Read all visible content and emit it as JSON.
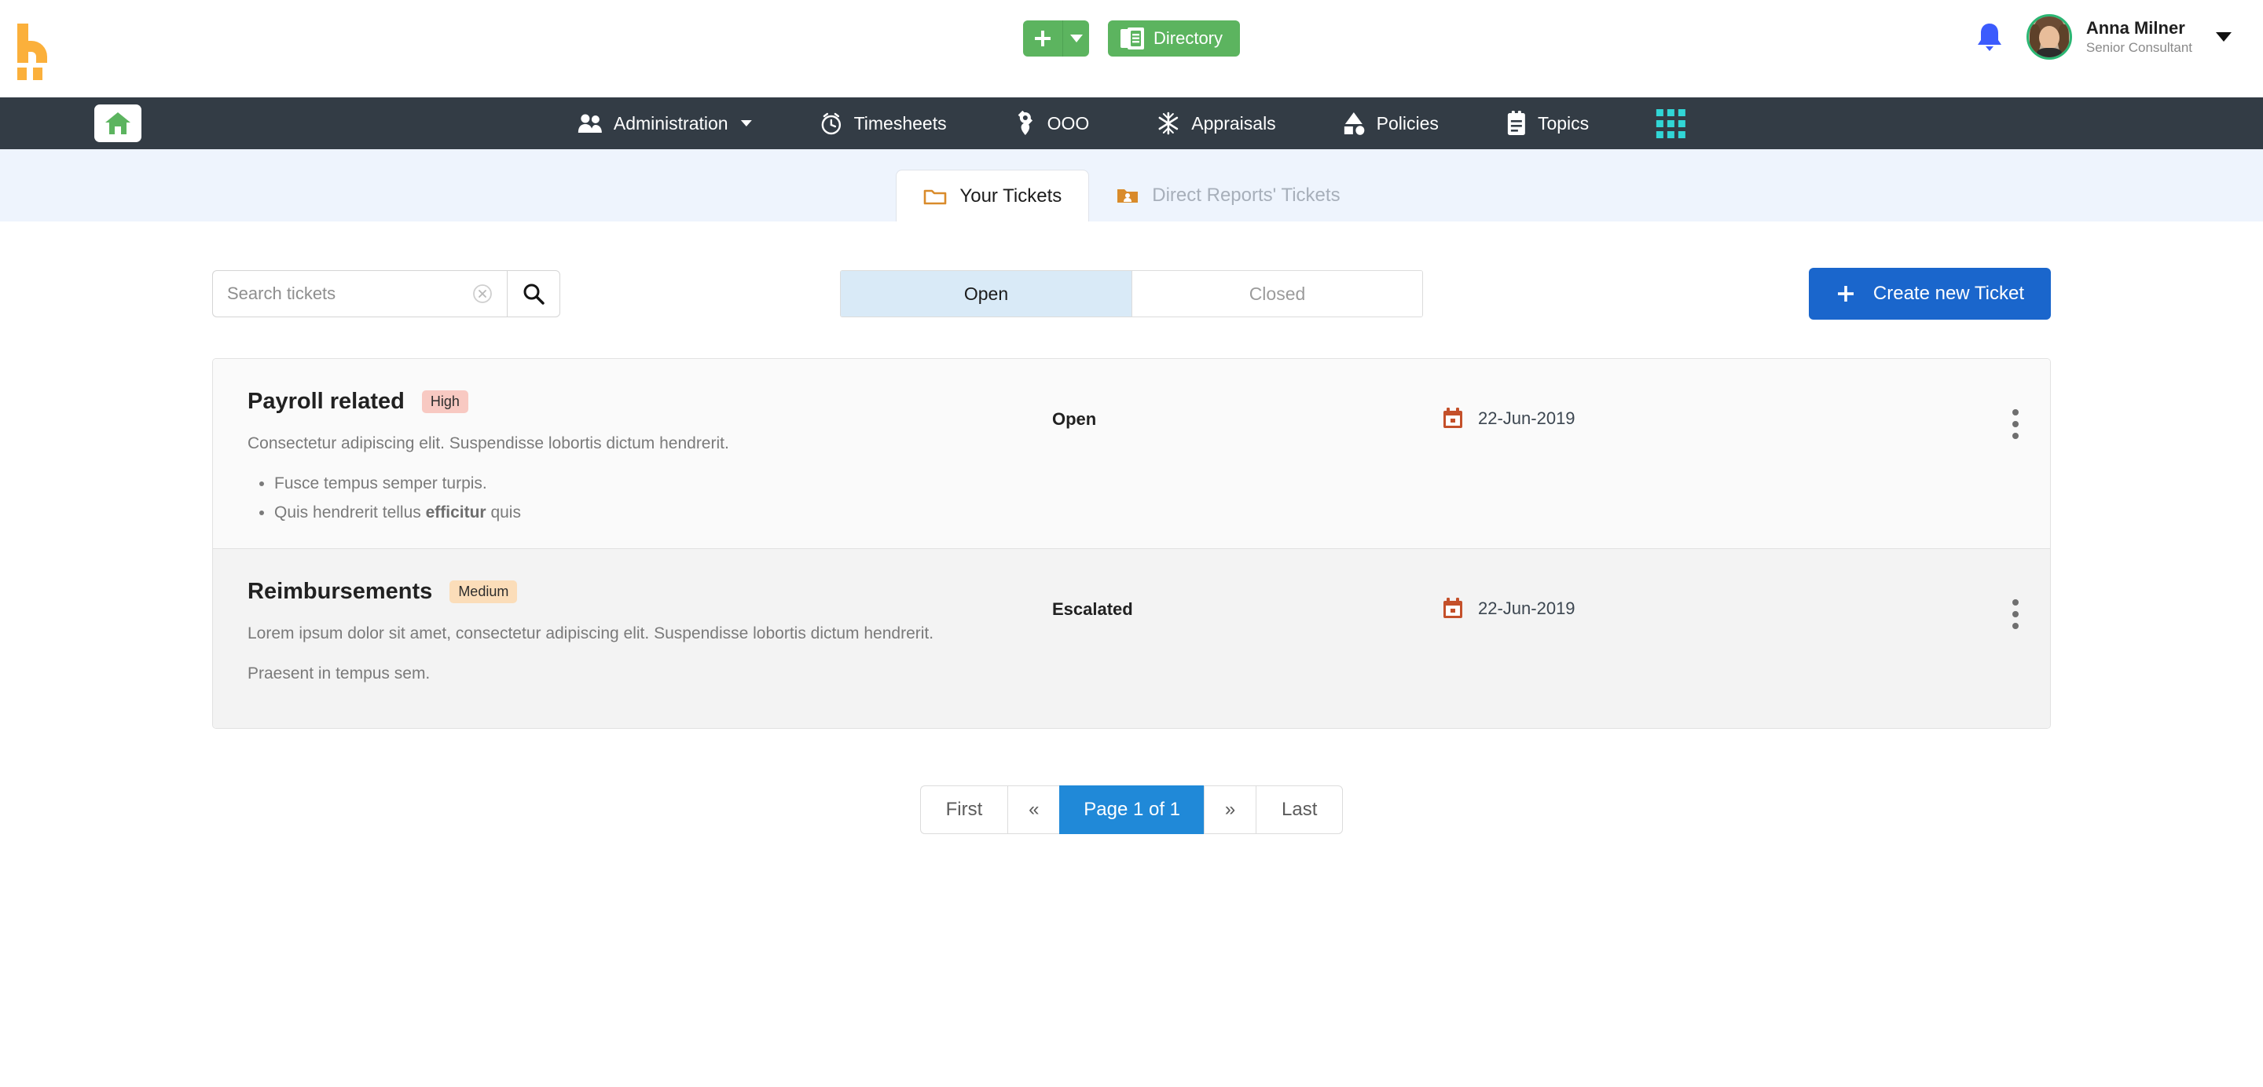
{
  "brand": {
    "logo_icon": "hibob-h-logo",
    "accent": "#fbb03b"
  },
  "topbar": {
    "add_button": {
      "label": "+",
      "icon": "plus-icon",
      "color": "#5cb45f"
    },
    "add_dropdown": {
      "icon": "caret-down-icon"
    },
    "directory_button": {
      "label": "Directory",
      "icon": "address-book-icon"
    },
    "notifications": {
      "icon": "bell-icon",
      "color": "#3b5bfd"
    },
    "user": {
      "name": "Anna Milner",
      "role": "Senior Consultant",
      "avatar_icon": "user-avatar",
      "caret_icon": "caret-down-icon",
      "ring_color": "#2bb673"
    }
  },
  "nav": {
    "home": {
      "icon": "home-icon",
      "color": "#5cb45f"
    },
    "bar_color": "#333c45",
    "items": [
      {
        "label": "Administration",
        "icon": "people-icon",
        "has_caret": true
      },
      {
        "label": "Timesheets",
        "icon": "alarm-clock-icon",
        "has_caret": false
      },
      {
        "label": "OOO",
        "icon": "flower-icon",
        "has_caret": false
      },
      {
        "label": "Appraisals",
        "icon": "asterisk-star-icon",
        "has_caret": false
      },
      {
        "label": "Policies",
        "icon": "shapes-icon",
        "has_caret": false
      },
      {
        "label": "Topics",
        "icon": "clipboard-icon",
        "has_caret": false
      }
    ],
    "apps": {
      "icon": "apps-grid-icon",
      "color": "#31d6d6"
    }
  },
  "tabs": [
    {
      "label": "Your Tickets",
      "icon": "folder-outline-icon",
      "active": true
    },
    {
      "label": "Direct Reports' Tickets",
      "icon": "folder-user-icon",
      "active": false
    }
  ],
  "toolbar": {
    "search": {
      "value": "",
      "placeholder": "Search tickets",
      "clear_icon": "circle-x-icon",
      "search_icon": "search-icon"
    },
    "segments": [
      {
        "label": "Open",
        "active": true
      },
      {
        "label": "Closed",
        "active": false
      }
    ],
    "create_button": {
      "label": "Create new Ticket",
      "icon": "plus-icon",
      "color": "#1a66cc"
    }
  },
  "tickets": [
    {
      "title": "Payroll related",
      "priority": "High",
      "priority_color": "#f8c9c2",
      "description": "Consectetur adipiscing elit. Suspendisse lobortis dictum hendrerit.",
      "bullets": [
        {
          "text": "Fusce tempus semper turpis.",
          "bold": ""
        },
        {
          "text": "Quis hendrerit tellus ",
          "bold": "efficitur",
          "tail": " quis"
        }
      ],
      "extra": "",
      "status": "Open",
      "date": "22-Jun-2019",
      "date_icon": "calendar-icon",
      "menu_icon": "kebab-menu-icon"
    },
    {
      "title": "Reimbursements",
      "priority": "Medium",
      "priority_color": "#fbddb9",
      "description": "Lorem ipsum dolor sit amet, consectetur adipiscing elit. Suspendisse lobortis dictum hendrerit.",
      "bullets": [],
      "extra": "Praesent in tempus sem.",
      "status": "Escalated",
      "date": "22-Jun-2019",
      "date_icon": "calendar-icon",
      "menu_icon": "kebab-menu-icon"
    }
  ],
  "pagination": {
    "first": "First",
    "prev": "«",
    "current": "Page 1 of 1",
    "next": "»",
    "last": "Last",
    "active_color": "#2089d8"
  }
}
